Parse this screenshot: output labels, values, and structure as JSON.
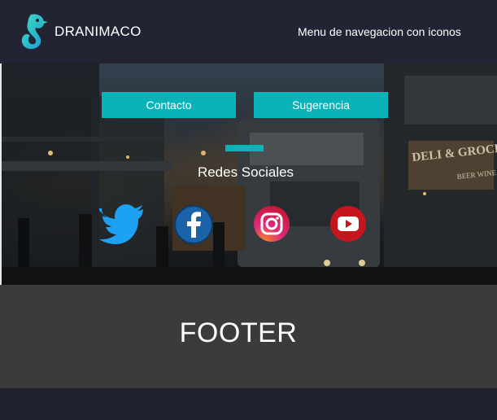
{
  "header": {
    "brand": "DRANIMACO",
    "nav_title": "Menu de navegacion con iconos",
    "logo_icon": "seahorse-logo-icon"
  },
  "hero": {
    "buttons": {
      "contact_label": "Contacto",
      "suggestion_label": "Sugerencia"
    },
    "social_title": "Redes Sociales",
    "social_icons": [
      "twitter-icon",
      "facebook-icon",
      "instagram-icon",
      "youtube-icon"
    ],
    "background_scene": "cyberpunk-street-night"
  },
  "footer": {
    "label": "FOOTER"
  },
  "colors": {
    "accent": "#0ab3b8",
    "header_bg": "#232433",
    "footer_bg": "#3b3b3b",
    "page_bg": "#1e1f2c"
  }
}
